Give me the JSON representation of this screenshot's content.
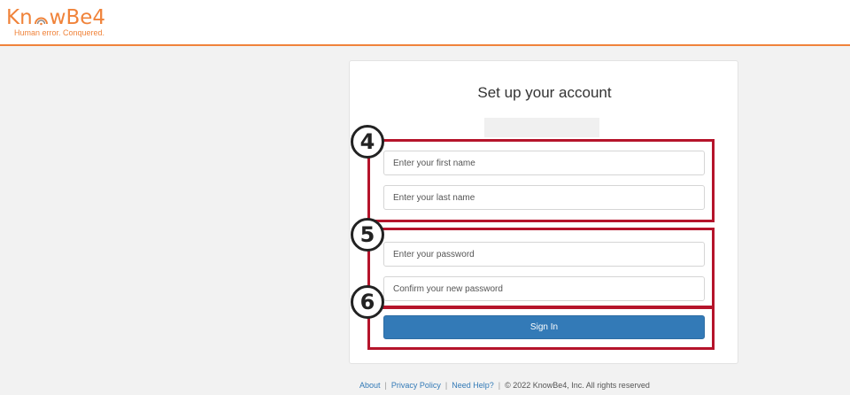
{
  "brand": {
    "name_prefix": "Kn",
    "name_suffix": "wBe4",
    "tagline": "Human error. Conquered.",
    "accent": "#f0833a"
  },
  "form": {
    "title": "Set up your account",
    "first_name_placeholder": "Enter your first name",
    "last_name_placeholder": "Enter your last name",
    "password_placeholder": "Enter your password",
    "confirm_password_placeholder": "Confirm your new password",
    "submit_label": "Sign In",
    "button_color": "#337ab7"
  },
  "annotations": {
    "step_4": "4",
    "step_5": "5",
    "step_6": "6",
    "box_color": "#b5142b"
  },
  "footer": {
    "about": "About",
    "privacy": "Privacy Policy",
    "help": "Need Help?",
    "copyright": "© 2022 KnowBe4, Inc. All rights reserved",
    "separator": "|"
  }
}
